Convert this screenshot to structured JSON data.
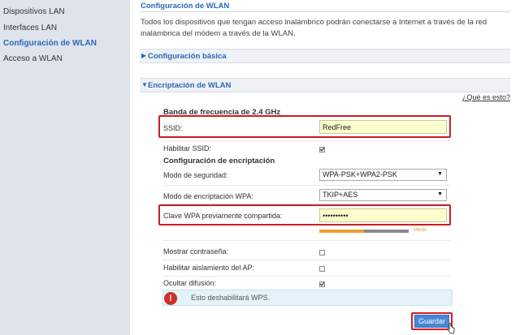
{
  "sidebar": {
    "items": [
      {
        "label": "Dispositivos LAN"
      },
      {
        "label": "Interfaces LAN"
      },
      {
        "label": "Configuración de WLAN"
      },
      {
        "label": "Acceso a WLAN"
      }
    ]
  },
  "main": {
    "title": "Configuración de WLAN",
    "description": "Todos los dispositivos que tengan acceso inalámbrico podrán conectarse a Internet a través de la red inalámbrica del módem a través de la WLAN.",
    "sections": {
      "basic": "Configuración básica",
      "encryption": "Encriptación de WLAN"
    },
    "help_link": "¿Qué es esto?",
    "band_heading": "Banda de frecuencia de 2.4 GHz",
    "ssid": {
      "label": "SSID:",
      "value": "RedFree"
    },
    "enable_ssid": {
      "label": "Habilitar SSID:",
      "checked": true
    },
    "encryption_heading": "Configuración de encriptación",
    "security_mode": {
      "label": "Modo de seguridad:",
      "value": "WPA-PSK+WPA2-PSK"
    },
    "wpa_mode": {
      "label": "Modo de encriptación WPA:",
      "value": "TKIP+AES"
    },
    "psk": {
      "label": "Clave WPA previamente compartida:",
      "value": "••••••••••"
    },
    "strength": {
      "label": "Medio",
      "level": 0.5,
      "colors": [
        "#f0a030",
        "#8a8a8a"
      ]
    },
    "show_password": {
      "label": "Mostrar contraseña:",
      "checked": false
    },
    "ap_isolation": {
      "label": "Habilitar aislamiento del AP:",
      "checked": false
    },
    "hide_broadcast": {
      "label": "Ocultar difusión:",
      "checked": true
    },
    "warning": {
      "icon": "exclamation-icon",
      "text": "Esto deshabilitará WPS."
    },
    "save_label": "Guardar"
  },
  "colors": {
    "accent": "#2c68b8",
    "highlight": "#cc1d24",
    "input_bg": "#fcfccc",
    "sidebar_bg": "#dfe4ec",
    "button_bg": "#4a86d6"
  }
}
